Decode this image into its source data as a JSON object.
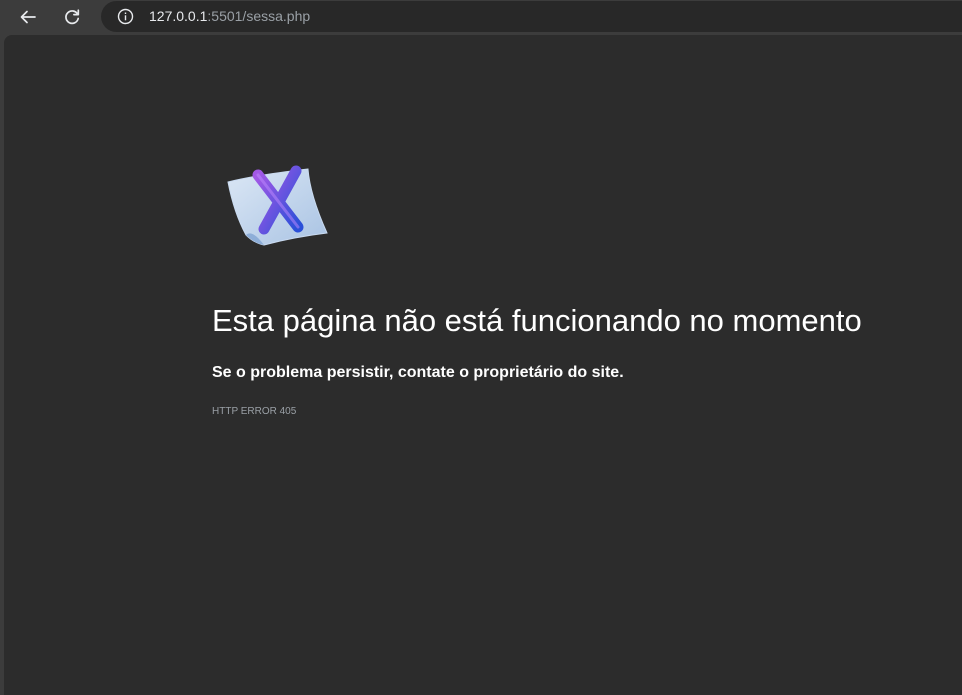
{
  "browser": {
    "back_icon": "arrow-left-icon",
    "reload_icon": "reload-icon",
    "info_icon": "info-icon",
    "url_host": "127.0.0.1",
    "url_rest": ":5501/sessa.php"
  },
  "error_page": {
    "icon": "broken-page-x-icon",
    "title": "Esta página não está funcionando no momento",
    "description": "Se o problema persistir, contate o proprietário do site.",
    "code": "HTTP ERROR 405"
  },
  "colors": {
    "toolbar_bg": "#3c3c3c",
    "omnibox_bg": "#282828",
    "page_bg": "#2c2c2c",
    "title_text": "#ffffff",
    "code_text": "#9aa0a6"
  }
}
